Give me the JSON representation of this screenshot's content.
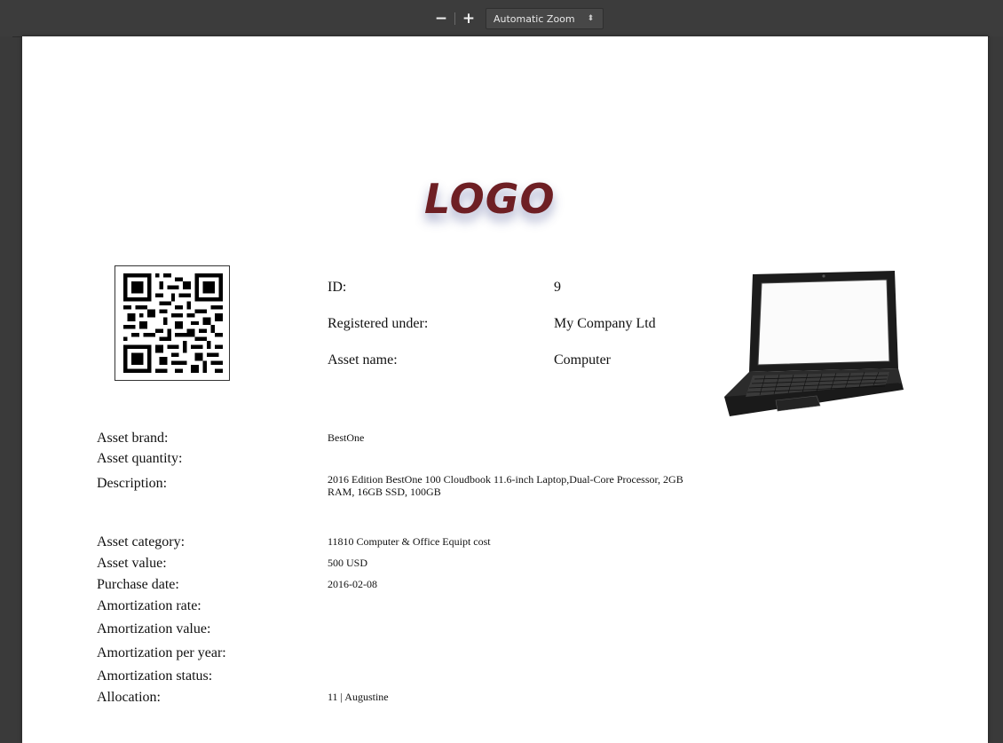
{
  "toolbar": {
    "zoom_out": "−",
    "zoom_in": "+",
    "zoom_select": "Automatic Zoom",
    "zoom_arrow": "⬍"
  },
  "document": {
    "logo_text": "LOGO",
    "header_fields": [
      {
        "label": "ID:",
        "value": "9"
      },
      {
        "label": "Registered under:",
        "value": "My Company Ltd"
      },
      {
        "label": "Asset name:",
        "value": "Computer"
      }
    ],
    "fields": [
      {
        "label": "Asset brand:",
        "value": "BestOne"
      },
      {
        "label": "Asset quantity:",
        "value": ""
      },
      {
        "label": "Description:",
        "value": "2016 Edition BestOne 100 Cloudbook 11.6-inch Laptop,Dual-Core Processor, 2GB RAM, 16GB SSD, 100GB"
      },
      {
        "label": "Asset category:",
        "value": "11810 Computer & Office Equipt cost"
      },
      {
        "label": "Asset value:",
        "value": "500 USD"
      },
      {
        "label": "Purchase date:",
        "value": "2016-02-08"
      },
      {
        "label": "Amortization rate:",
        "value": ""
      },
      {
        "label": "Amortization value:",
        "value": ""
      },
      {
        "label": "Amortization per year:",
        "value": ""
      },
      {
        "label": "Amortization status:",
        "value": ""
      },
      {
        "label": "Allocation:",
        "value": "11 | Augustine"
      }
    ]
  },
  "colors": {
    "logo": "#6e1f24",
    "toolbar_bg": "#3c3c3c",
    "page_bg": "#ffffff"
  },
  "icons": [
    "zoom-out-icon",
    "zoom-in-icon",
    "qr-code-icon",
    "laptop-image"
  ]
}
